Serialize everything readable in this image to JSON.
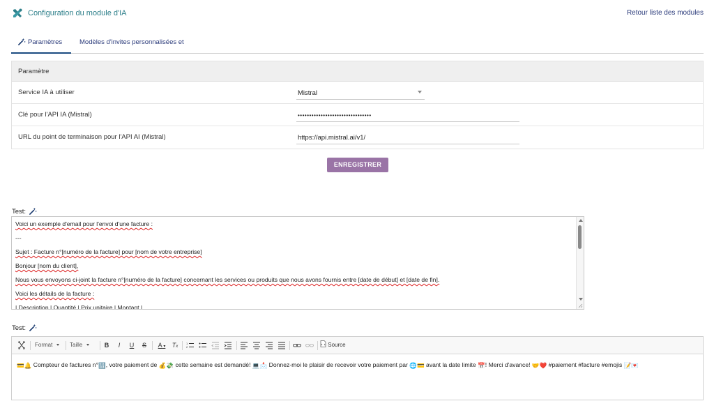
{
  "header": {
    "title": "Configuration du module d'IA",
    "back_link": "Retour liste des modules"
  },
  "tabs": [
    {
      "label": "Paramètres",
      "active": true
    },
    {
      "label": "Modèles d'invites personnalisées et",
      "active": false
    }
  ],
  "params": {
    "heading": "Paramètre",
    "rows": [
      {
        "label": "Service IA à utiliser",
        "value": "Mistral",
        "type": "select"
      },
      {
        "label": "Clé pour l'API IA (Mistral)",
        "value": "••••••••••••••••••••••••••••••••",
        "type": "password"
      },
      {
        "label": "URL du point de terminaison pour l'API AI (Mistral)",
        "value": "https://api.mistral.ai/v1/",
        "type": "text"
      }
    ]
  },
  "save_button": "ENREGISTRER",
  "test1": {
    "label": "Test:",
    "lines": [
      "Voici un exemple d'email pour l'envoi d'une facture :",
      "---",
      "Sujet : Facture n°[numéro de la facture] pour [nom de votre entreprise]",
      "Bonjour [nom du client],",
      "Nous vous envoyons ci-joint la facture n°[numéro de la facture] concernant les services ou produits que nous avons fournis entre [date de début] et [date de fin].",
      "Voici les détails de la facture :",
      "| Description | Quantité | Prix unitaire | Montant |"
    ]
  },
  "test2": {
    "label": "Test:",
    "toolbar": {
      "format": "Format",
      "size": "Taille",
      "bold": "B",
      "italic": "I",
      "underline": "U",
      "strike": "S",
      "text_color": "A",
      "clear_format": "T",
      "source": "Source"
    },
    "body_parts": [
      " Compteur de factures n°",
      ", votre paiement de ",
      " cette semaine est demandé! ",
      " Donnez-moi le plaisir de recevoir votre paiement par ",
      " avant la date limite ",
      "! Merci d'avance! ",
      " #paiement #facture #emojis "
    ]
  },
  "colors": {
    "accent": "#2d7f8a",
    "link": "#2a3a7a",
    "button": "#9a74a6",
    "header_bg": "#efefef"
  },
  "icons": [
    "tools-icon",
    "magic-wand-icon",
    "fullscreen-icon",
    "link-icon",
    "unlink-icon",
    "source-icon"
  ]
}
